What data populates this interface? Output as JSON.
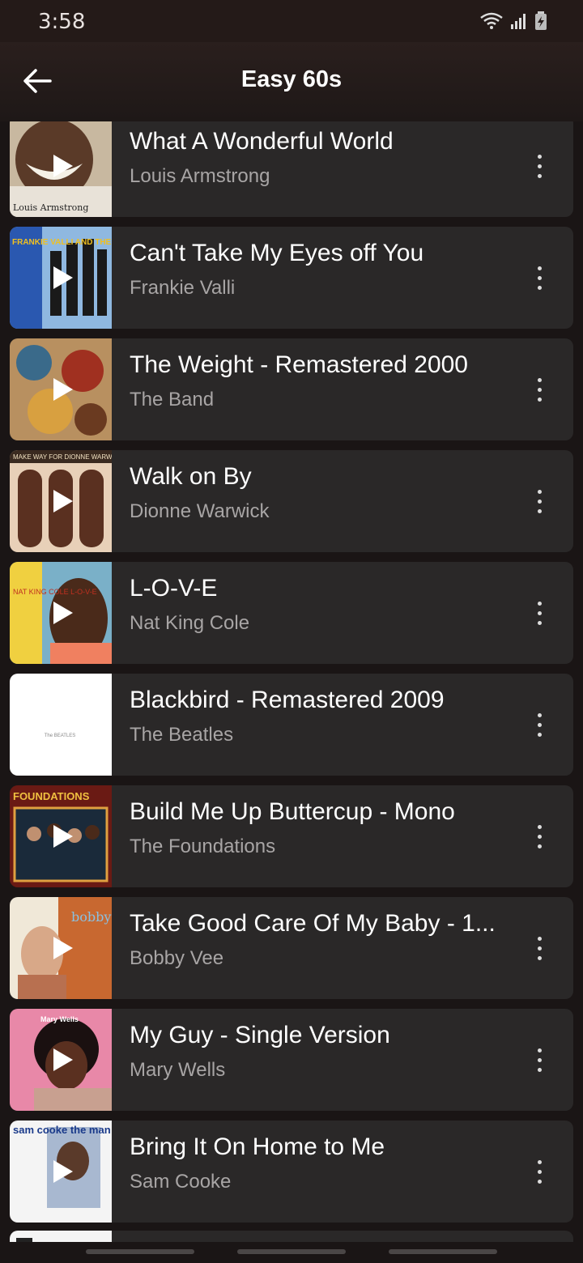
{
  "status_bar": {
    "time": "3:58",
    "icons": [
      "wifi-icon",
      "signal-icon",
      "battery-charging-icon"
    ]
  },
  "header": {
    "back_icon": "arrow-left-icon",
    "title": "Easy 60s"
  },
  "tracks": [
    {
      "title": "What A Wonderful World",
      "artist": "Louis Armstrong",
      "art_text": "Louis Armstrong"
    },
    {
      "title": "Can't Take My Eyes off You",
      "artist": "Frankie Valli",
      "art_text": "FRANKIE VALLI AND THE FOUR SEASONS"
    },
    {
      "title": "The Weight - Remastered 2000",
      "artist": "The Band",
      "art_text": ""
    },
    {
      "title": "Walk on By",
      "artist": "Dionne Warwick",
      "art_text": "MAKE WAY FOR DIONNE WARWICK"
    },
    {
      "title": "L-O-V-E",
      "artist": "Nat King Cole",
      "art_text": "NAT KING COLE L-O-V-E"
    },
    {
      "title": "Blackbird - Remastered 2009",
      "artist": "The Beatles",
      "art_text": "The BEATLES"
    },
    {
      "title": "Build Me Up Buttercup - Mono",
      "artist": "The Foundations",
      "art_text": "FOUNDATIONS"
    },
    {
      "title": "Take Good Care Of My Baby - 1...",
      "artist": "Bobby Vee",
      "art_text": "bobby vee"
    },
    {
      "title": "My Guy - Single Version",
      "artist": "Mary Wells",
      "art_text": "Mary Wells"
    },
    {
      "title": "Bring It On Home to Me",
      "artist": "Sam Cooke",
      "art_text": "sam cooke the man who invented soul"
    }
  ],
  "colors": {
    "background": "#1a1515",
    "card": "#2a2828",
    "secondary_text": "#a8a5a5"
  }
}
